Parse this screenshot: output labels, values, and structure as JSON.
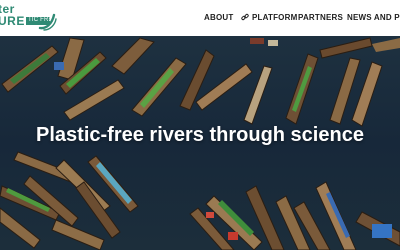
{
  "logo": {
    "word_top": "ter",
    "word_bottom": "URE",
    "tagline": "TIC FREE RIVERS",
    "color": "#2f8a74"
  },
  "nav": {
    "items": [
      {
        "label": "ABOUT"
      },
      {
        "label": "PLATFORM",
        "icon": "link-icon"
      },
      {
        "label": "PARTNERS"
      },
      {
        "label": "NEWS AND PUB"
      }
    ]
  },
  "hero": {
    "title": "Plastic-free rivers through science",
    "image": "aerial-photo-of-moored-wooden-boats-on-river"
  }
}
